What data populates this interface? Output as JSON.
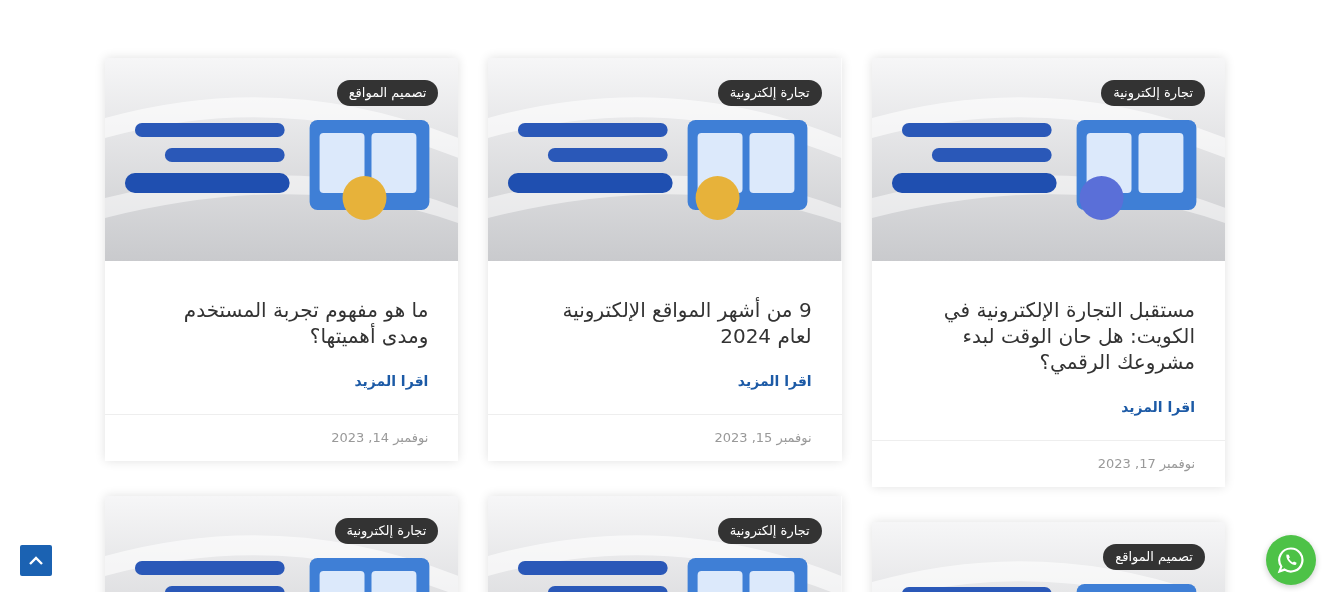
{
  "posts": [
    {
      "category": "تجارة إلكترونية",
      "title": "مستقبل التجارة الإلكترونية في الكويت: هل حان الوقت لبدء مشروعك الرقمي؟",
      "read_more": "اقرا المزيد",
      "date": "نوفمبر 17, 2023"
    },
    {
      "category": "تجارة إلكترونية",
      "title": "9 من أشهر المواقع الإلكترونية لعام 2024",
      "read_more": "اقرا المزيد",
      "date": "نوفمبر 15, 2023"
    },
    {
      "category": "تصميم المواقع",
      "title": "ما هو مفهوم تجربة المستخدم ومدى أهميتها؟",
      "read_more": "اقرا المزيد",
      "date": "نوفمبر 14, 2023"
    },
    {
      "category": "تصميم المواقع"
    },
    {
      "category": "تجارة إلكترونية"
    },
    {
      "category": "تجارة إلكترونية"
    }
  ]
}
